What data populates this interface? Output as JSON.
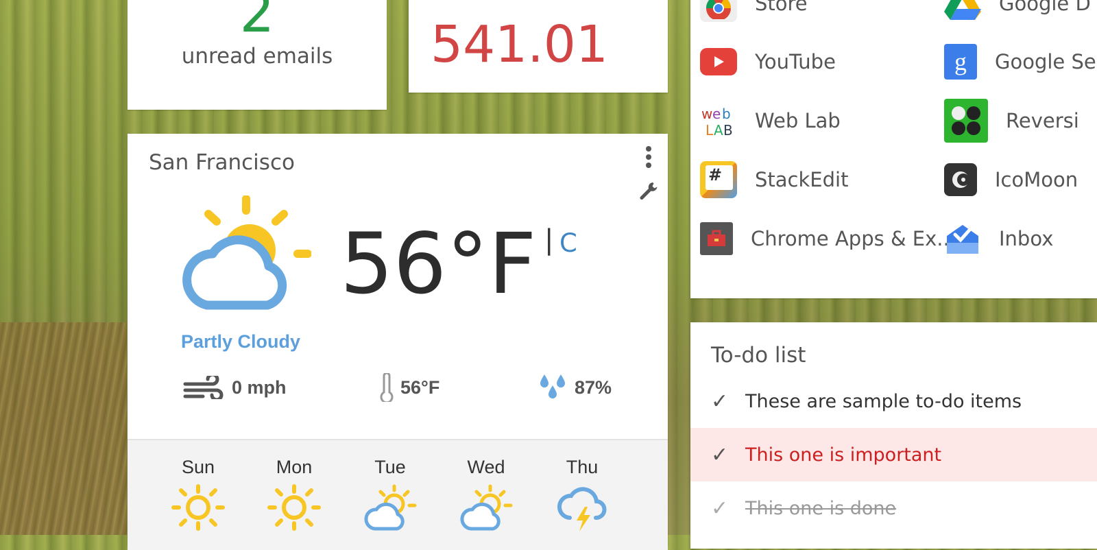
{
  "email": {
    "count": "2",
    "label": "unread emails"
  },
  "stock": {
    "value": "541.01"
  },
  "weather": {
    "city": "San Francisco",
    "temperature": "56°F",
    "unit_separator": "|",
    "unit_toggle": "C",
    "condition": "Partly Cloudy",
    "wind": "0 mph",
    "feels_like": "56°F",
    "humidity": "87%",
    "forecast": [
      {
        "day": "Sun",
        "icon": "sun-icon"
      },
      {
        "day": "Mon",
        "icon": "sun-icon"
      },
      {
        "day": "Tue",
        "icon": "partly-cloudy-icon"
      },
      {
        "day": "Wed",
        "icon": "partly-cloudy-icon"
      },
      {
        "day": "Thu",
        "icon": "thunderstorm-icon"
      }
    ],
    "colors": {
      "sun": "#f7c625",
      "cloud": "#6aa8e0",
      "condition_text": "#5b9fdc",
      "toggle": "#3d86c6"
    }
  },
  "apps": [
    {
      "label": "Store",
      "icon": "chrome-store-icon"
    },
    {
      "label": "Google D",
      "icon": "google-drive-icon"
    },
    {
      "label": "YouTube",
      "icon": "youtube-icon"
    },
    {
      "label": "Google Se",
      "icon": "google-search-icon"
    },
    {
      "label": "Web Lab",
      "icon": "web-lab-icon"
    },
    {
      "label": "Reversi",
      "icon": "reversi-icon"
    },
    {
      "label": "StackEdit",
      "icon": "stackedit-icon"
    },
    {
      "label": "IcoMoon",
      "icon": "icomoon-icon"
    },
    {
      "label": "Chrome Apps & Ex...",
      "icon": "toolbox-icon"
    },
    {
      "label": "Inbox",
      "icon": "inbox-icon"
    }
  ],
  "todo": {
    "title": "To-do list",
    "check_glyph": "✓",
    "items": [
      {
        "text": "These are sample to-do items",
        "state": "normal"
      },
      {
        "text": "This one is important",
        "state": "important"
      },
      {
        "text": "This one is done",
        "state": "done"
      }
    ]
  }
}
